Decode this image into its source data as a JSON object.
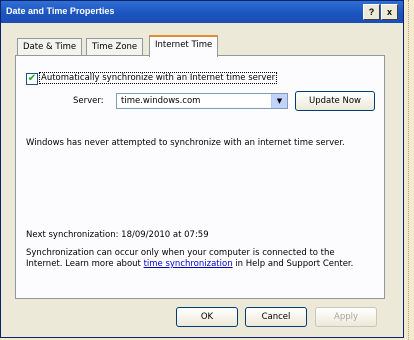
{
  "window": {
    "title": "Date and Time Properties",
    "help_btn": "?",
    "close_btn": "x"
  },
  "tabs": [
    {
      "label": "Date & Time",
      "active": false
    },
    {
      "label": "Time Zone",
      "active": false
    },
    {
      "label": "Internet Time",
      "active": true
    }
  ],
  "internet_time": {
    "auto_sync_checked": true,
    "auto_sync_check_glyph": "✔",
    "auto_sync_label": "Automatically synchronize with an Internet time server",
    "server_label": "Server:",
    "server_value": "time.windows.com",
    "dropdown_glyph": "▼",
    "update_button": "Update Now",
    "status_message": "Windows has never attempted to synchronize with an internet time server.",
    "next_sync": "Next synchronization: 18/09/2010 at 07:59",
    "note_prefix": "Synchronization can occur only when your computer is connected to the Internet.  Learn more about ",
    "note_link": "time synchronization",
    "note_suffix": " in Help and Support Center."
  },
  "buttons": {
    "ok": "OK",
    "cancel": "Cancel",
    "apply": "Apply"
  },
  "colors": {
    "titlebar": "#1d55bf",
    "link": "#0000cc",
    "check": "#21a121"
  }
}
